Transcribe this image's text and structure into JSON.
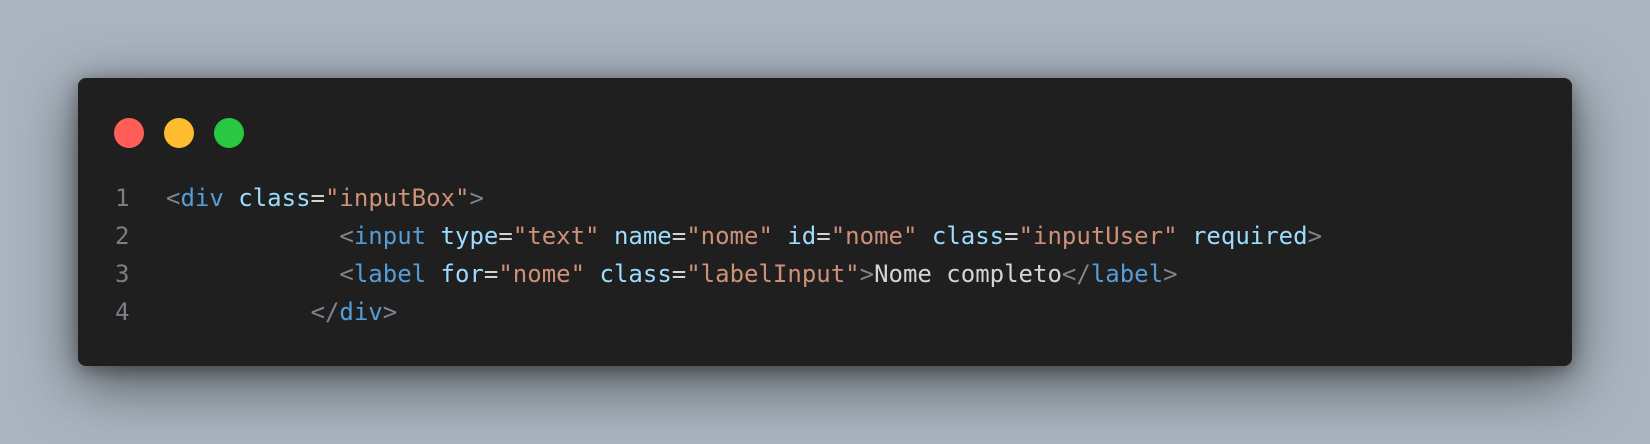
{
  "window": {
    "controls": [
      {
        "name": "close",
        "color": "#ff5f57"
      },
      {
        "name": "minimize",
        "color": "#febc2e"
      },
      {
        "name": "maximize",
        "color": "#28c840"
      }
    ]
  },
  "code": {
    "lines": [
      {
        "number": "1",
        "indent": "",
        "tokens": [
          {
            "type": "punct",
            "text": "<"
          },
          {
            "type": "tag",
            "text": "div"
          },
          {
            "type": "txt",
            "text": " "
          },
          {
            "type": "attr",
            "text": "class"
          },
          {
            "type": "eq",
            "text": "="
          },
          {
            "type": "str",
            "text": "\"inputBox\""
          },
          {
            "type": "punct",
            "text": ">"
          }
        ]
      },
      {
        "number": "2",
        "indent": "            ",
        "tokens": [
          {
            "type": "punct",
            "text": "<"
          },
          {
            "type": "tag",
            "text": "input"
          },
          {
            "type": "txt",
            "text": " "
          },
          {
            "type": "attr",
            "text": "type"
          },
          {
            "type": "eq",
            "text": "="
          },
          {
            "type": "str",
            "text": "\"text\""
          },
          {
            "type": "txt",
            "text": " "
          },
          {
            "type": "attr",
            "text": "name"
          },
          {
            "type": "eq",
            "text": "="
          },
          {
            "type": "str",
            "text": "\"nome\""
          },
          {
            "type": "txt",
            "text": " "
          },
          {
            "type": "attr",
            "text": "id"
          },
          {
            "type": "eq",
            "text": "="
          },
          {
            "type": "str",
            "text": "\"nome\""
          },
          {
            "type": "txt",
            "text": " "
          },
          {
            "type": "attr",
            "text": "class"
          },
          {
            "type": "eq",
            "text": "="
          },
          {
            "type": "str",
            "text": "\"inputUser\""
          },
          {
            "type": "txt",
            "text": " "
          },
          {
            "type": "attr",
            "text": "required"
          },
          {
            "type": "punct",
            "text": ">"
          }
        ]
      },
      {
        "number": "3",
        "indent": "            ",
        "tokens": [
          {
            "type": "punct",
            "text": "<"
          },
          {
            "type": "tag",
            "text": "label"
          },
          {
            "type": "txt",
            "text": " "
          },
          {
            "type": "attr",
            "text": "for"
          },
          {
            "type": "eq",
            "text": "="
          },
          {
            "type": "str",
            "text": "\"nome\""
          },
          {
            "type": "txt",
            "text": " "
          },
          {
            "type": "attr",
            "text": "class"
          },
          {
            "type": "eq",
            "text": "="
          },
          {
            "type": "str",
            "text": "\"labelInput\""
          },
          {
            "type": "punct",
            "text": ">"
          },
          {
            "type": "txt",
            "text": "Nome completo"
          },
          {
            "type": "punct",
            "text": "</"
          },
          {
            "type": "tag",
            "text": "label"
          },
          {
            "type": "punct",
            "text": ">"
          }
        ]
      },
      {
        "number": "4",
        "indent": "          ",
        "tokens": [
          {
            "type": "punct",
            "text": "</"
          },
          {
            "type": "tag",
            "text": "div"
          },
          {
            "type": "punct",
            "text": ">"
          }
        ]
      }
    ]
  }
}
